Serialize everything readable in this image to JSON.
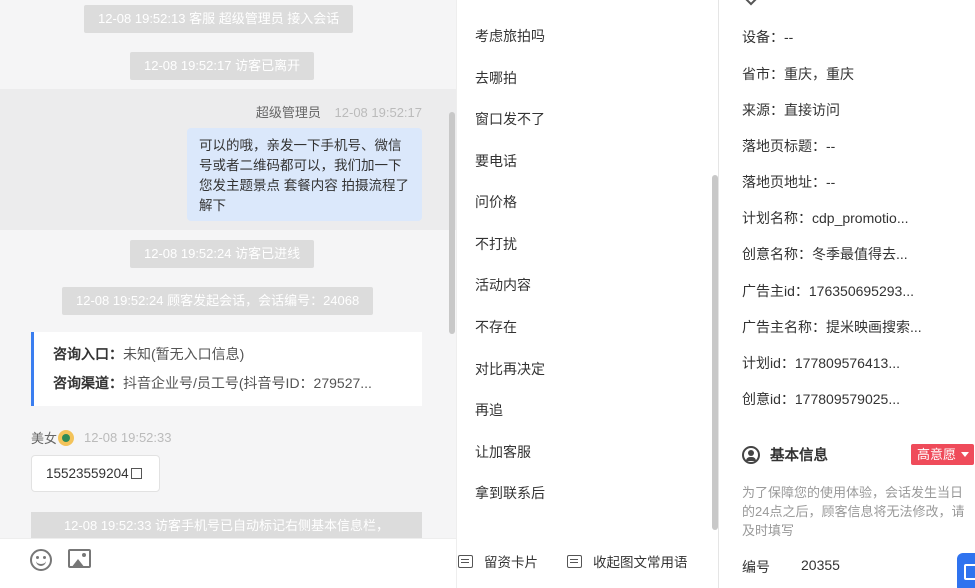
{
  "chat": {
    "sys1": "12-08 19:52:13 客服 超级管理员 接入会话",
    "sys2": "12-08 19:52:17 访客已离开",
    "agent_name": "超级管理员",
    "agent_time": "12-08 19:52:17",
    "agent_message": "可以的哦，亲发一下手机号、微信号或者二维码都可以，我们加一下您发主题景点 套餐内容 拍摄流程了解下",
    "sys3": "12-08 19:52:24 访客已进线",
    "sys4": "12-08 19:52:24 顾客发起会话，会话编号：24068",
    "consult_entry_label": "咨询入口：",
    "consult_entry_value": "未知(暂无入口信息)",
    "consult_channel_label": "咨询渠道：",
    "consult_channel_value": "抖音企业号/员工号(抖音号ID：279527...",
    "visitor_name": "美女",
    "visitor_time": "12-08 19:52:33",
    "visitor_phone": "15523559204",
    "sys5": "12-08 19:52:33 访客手机号已自动标记右侧基本信息栏，"
  },
  "toolbar": {
    "emoji_icon": "smiley-icon",
    "image_icon": "image-icon",
    "card_label": "留资卡片",
    "collapse_label": "收起图文常用语"
  },
  "phrases": [
    "考虑旅拍吗",
    "去哪拍",
    "窗口发不了",
    "要电话",
    "问价格",
    "不打扰",
    "活动内容",
    "不存在",
    "对比再决定",
    "再追",
    "让加客服",
    "拿到联系后"
  ],
  "info": {
    "rows": [
      "设备：--",
      "省市：重庆，重庆",
      "来源：直接访问",
      "落地页标题：--",
      "落地页地址：--",
      "计划名称：cdp_promotio...",
      "创意名称：冬季最值得去...",
      "广告主id：176350695293...",
      "广告主名称：提米映画搜索...",
      "计划id：177809576413...",
      "创意id：177809579025..."
    ],
    "basic_title": "基本信息",
    "intent": "高意愿",
    "notice": "为了保障您的使用体验，会话发生当日的24点之后，顾客信息将无法修改，请及时填写",
    "serial_label": "编号",
    "serial_value": "20355"
  },
  "colors": {
    "accent": "#3a7ef0",
    "agent_bubble": "#dbe8fb",
    "intent_badge": "#ef4b5a",
    "system_tag": "#dcdcdc"
  }
}
